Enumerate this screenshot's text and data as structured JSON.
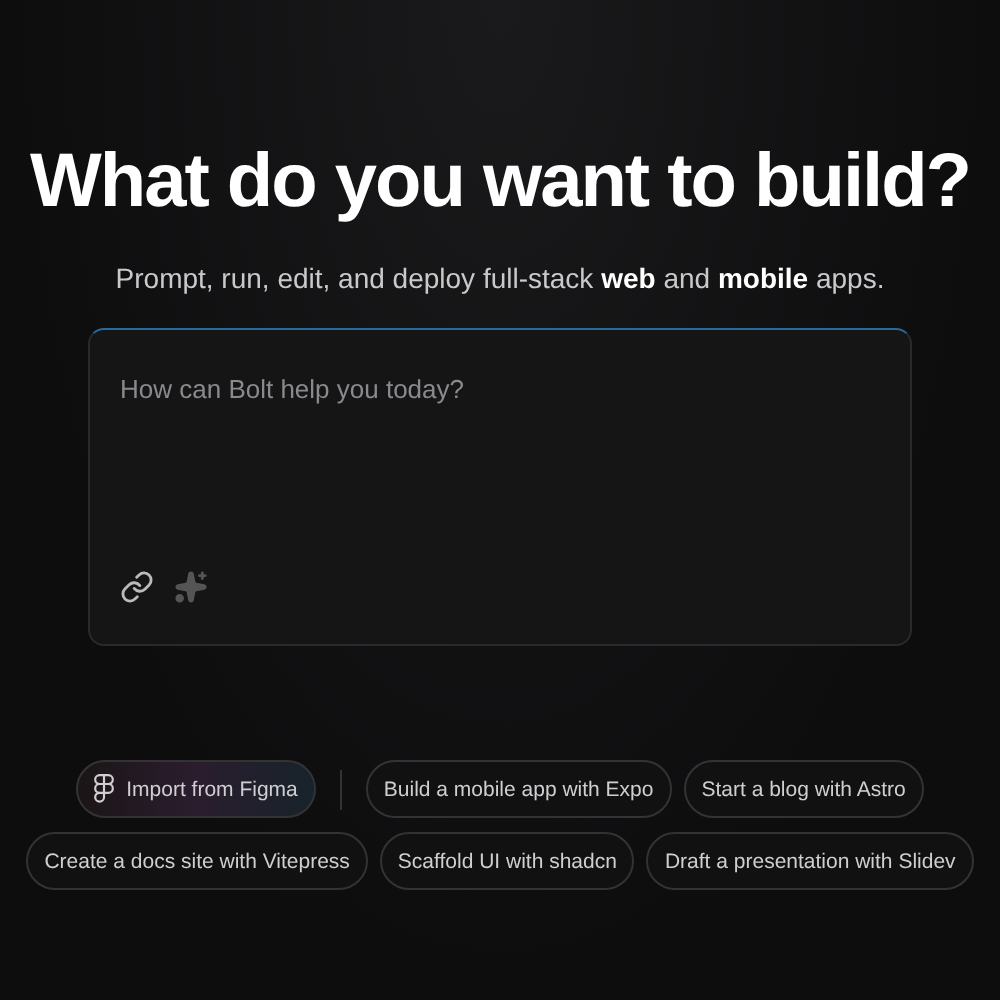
{
  "heading": "What do you want to build?",
  "subheading": "Prompt, run, edit, and deploy full-stack **web** and **mobile** apps.",
  "prompt": {
    "placeholder": "How can Bolt help you today?"
  },
  "suggestions": [
    {
      "kind": "import",
      "label": "Import from Figma"
    },
    {
      "kind": "divider"
    },
    {
      "kind": "plain",
      "label": "Build a mobile app with Expo"
    },
    {
      "kind": "plain",
      "label": "Start a blog with Astro"
    },
    {
      "kind": "plain",
      "label": "Create a docs site with Vitepress"
    },
    {
      "kind": "plain",
      "label": "Scaffold UI with shadcn"
    },
    {
      "kind": "plain",
      "label": "Draft a presentation with Slidev"
    }
  ]
}
